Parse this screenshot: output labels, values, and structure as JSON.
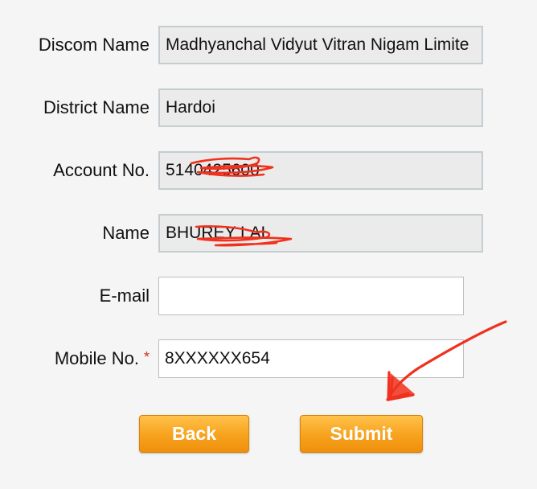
{
  "form": {
    "discom": {
      "label": "Discom Name",
      "value": "Madhyanchal Vidyut Vitran Nigam Limite"
    },
    "district": {
      "label": "District Name",
      "value": "Hardoi"
    },
    "account": {
      "label": "Account No.",
      "value": "5140425600"
    },
    "name": {
      "label": "Name",
      "value": "BHUREY LAL"
    },
    "email": {
      "label": "E-mail",
      "value": ""
    },
    "mobile": {
      "label": "Mobile No.",
      "required_mark": "*",
      "value": "8XXXXXX654"
    }
  },
  "buttons": {
    "back": "Back",
    "submit": "Submit"
  },
  "colors": {
    "button_orange": "#f7a21d",
    "annotation_red": "#f0311d",
    "required_star": "#d42a2a"
  },
  "annotations": [
    "redaction-scribble",
    "redaction-scribble",
    "pointer-arrow"
  ]
}
